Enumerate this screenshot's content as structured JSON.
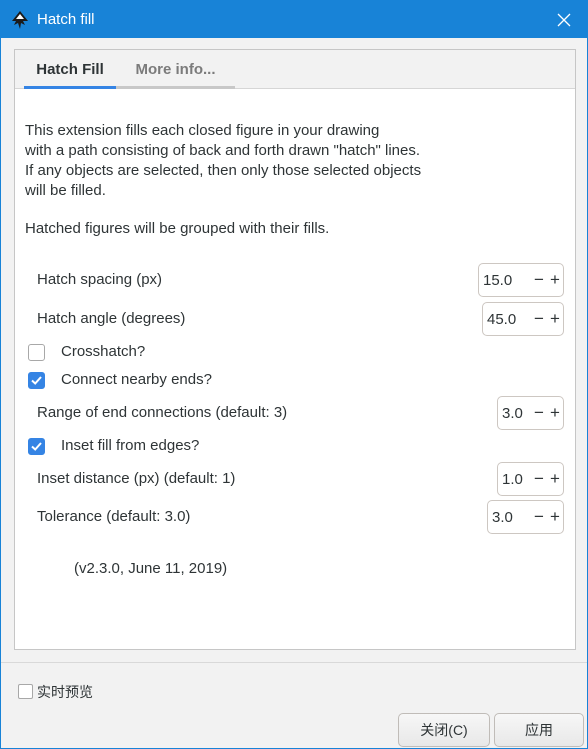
{
  "window": {
    "title": "Hatch fill",
    "accent_color": "#1883d7",
    "app_icon": "inkscape-icon",
    "close_icon": "close-icon"
  },
  "tabs": [
    {
      "label": "Hatch Fill",
      "active": true
    },
    {
      "label": "More info...",
      "active": false
    }
  ],
  "description": "This extension fills each closed figure in your drawing\nwith a path consisting of back and forth drawn \"hatch\" lines.\nIf any objects are selected, then only those selected objects\nwill be filled.",
  "note": "Hatched figures will be grouped with their fills.",
  "fields": {
    "hatch_spacing": {
      "label": "Hatch spacing (px)",
      "value": "15.0"
    },
    "hatch_angle": {
      "label": "Hatch angle (degrees)",
      "value": "45.0"
    },
    "crosshatch": {
      "label": "Crosshatch?",
      "checked": false
    },
    "connect_ends": {
      "label": "Connect nearby ends?",
      "checked": true
    },
    "range_end": {
      "label": "Range of end connections (default: 3)",
      "value": "3.0"
    },
    "inset_fill": {
      "label": "Inset fill from edges?",
      "checked": true
    },
    "inset_distance": {
      "label": "Inset distance (px) (default: 1)",
      "value": "1.0"
    },
    "tolerance": {
      "label": "Tolerance (default: 3.0)",
      "value": "3.0"
    }
  },
  "spin_buttons": {
    "minus": "−",
    "plus": "+"
  },
  "version": "(v2.3.0, June 11, 2019)",
  "footer": {
    "live_preview_label": "实时预览",
    "live_preview_checked": false,
    "close_label": "关闭(C)",
    "apply_label": "应用"
  }
}
